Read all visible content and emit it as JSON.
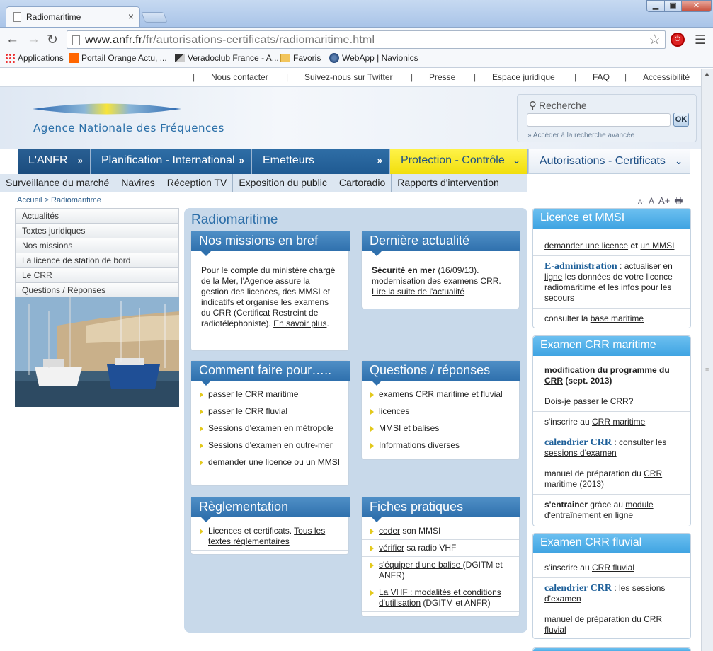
{
  "browser": {
    "tab_title": "Radiomaritime",
    "tab_close": "×",
    "url_host": "www.anfr.fr",
    "url_path": "/fr/autorisations-certificats/radiomaritime.html",
    "window_min": "▁",
    "window_max": "▣",
    "window_close": "✕",
    "bookmarks": [
      "Applications",
      "Portail Orange  Actu, ...",
      "Veradoclub France - A...",
      "Favoris",
      "WebApp | Navionics"
    ]
  },
  "toplinks": [
    "Nous contacter",
    "Suivez-nous sur Twitter",
    "Presse",
    "Espace juridique",
    "FAQ",
    "Accessibilité"
  ],
  "toplinks_sep": "|",
  "header": {
    "logo_text": "Agence Nationale des Fréquences",
    "search_title": "Recherche",
    "search_ok": "OK",
    "search_advanced": "Accéder à la recherche avancée",
    "search_advanced_marker": "»"
  },
  "mainnav": [
    {
      "label": "L'ANFR",
      "chev": "»"
    },
    {
      "label": "Planification - International",
      "chev": "»"
    },
    {
      "label": "Emetteurs",
      "chev": "»"
    },
    {
      "label": "Protection - Contrôle",
      "chev": "⌄"
    },
    {
      "label": "Autorisations - Certificats",
      "chev": "⌄"
    }
  ],
  "subnav": [
    "Surveillance du marché",
    "Navires",
    "Réception TV",
    "Exposition du public",
    "Cartoradio",
    "Rapports d'intervention"
  ],
  "breadcrumb": "Accueil > Radiomaritime",
  "fontsize": {
    "small": "A-",
    "normal": "A",
    "large": "A+",
    "print": "🖶"
  },
  "leftmenu": [
    "Actualités",
    "Textes juridiques",
    "Nos missions",
    "La licence de station de bord",
    "Le CRR",
    "Questions / Réponses"
  ],
  "center": {
    "title": "Radiomaritime",
    "missions": {
      "title": "Nos missions en bref",
      "text": "Pour le compte du ministère chargé de la Mer, l'Agence assure la gestion des licences, des MMSI et indicatifs et organise les examens du CRR (Certificat Restreint de radiotéléphoniste). ",
      "link": "En savoir plus",
      "end": "."
    },
    "actualite": {
      "title": "Dernière actualité",
      "bold": "Sécurité en mer",
      "date": " (16/09/13).",
      "text": "modernisation des examens CRR.",
      "link": "Lire la suite de l'actualité"
    },
    "comment": {
      "title": "Comment faire pour…..",
      "items": [
        {
          "pre": "passer le ",
          "link": "CRR maritime",
          "post": ""
        },
        {
          "pre": "passer le ",
          "link": "CRR fluvial",
          "post": ""
        },
        {
          "pre": "",
          "link": "Sessions d'examen en métropole",
          "post": ""
        },
        {
          "pre": "",
          "link": "Sessions d'examen en outre-mer",
          "post": ""
        },
        {
          "pre": "demander une ",
          "link": "licence",
          "mid": " ou un ",
          "link2": "MMSI"
        }
      ]
    },
    "questions": {
      "title": "Questions / réponses",
      "items": [
        "examens CRR maritime et fluvial",
        "licences",
        "MMSI et balises",
        "Informations diverses"
      ]
    },
    "reglementation": {
      "title": "Règlementation",
      "pre": "Licences et certificats. ",
      "link": "Tous les textes réglementaires"
    },
    "fiches": {
      "title": "Fiches pratiques",
      "items": [
        {
          "link": "coder",
          "post": " son MMSI"
        },
        {
          "link": "vérifier",
          "post": " sa radio VHF"
        },
        {
          "link": "s'équiper d'une balise ",
          "post": "(DGITM et ANFR)"
        },
        {
          "link": "La VHF : modalités et conditions d'utilisation",
          "post": " (DGITM et ANFR)"
        }
      ]
    }
  },
  "right": {
    "licence": {
      "title": "Licence et MMSI",
      "i1_link1": "demander une licence",
      "i1_mid": " et ",
      "i1_link2": "un MMSI",
      "i2_serif": "E-administration",
      "i2_colon": " : ",
      "i2_link": "actualiser en ligne",
      "i2_text": " les données de votre licence radiomaritime et les infos pour les secours",
      "i3_pre": "consulter la ",
      "i3_link": "base maritime"
    },
    "maritime": {
      "title": "Examen CRR maritime",
      "i1_link": "modification du programme du CRR",
      "i1_post": " (sept. 2013)",
      "i2_link": "Dois-je passer le CRR",
      "i2_post": "?",
      "i3_pre": "s'inscrire au ",
      "i3_link": "CRR maritime",
      "i4_serif": "calendrier CRR",
      "i4_mid": " :  consulter les ",
      "i4_link": "sessions d'examen",
      "i5_pre": "manuel de préparation du ",
      "i5_link": "CRR maritime",
      "i5_post": " (2013)",
      "i6_bold": "s'entrainer",
      "i6_mid": " grâce au ",
      "i6_link": "module d'entraînement en ligne"
    },
    "fluvial": {
      "title": "Examen CRR fluvial",
      "i1_pre": "s'inscrire au ",
      "i1_link": "CRR fluvial",
      "i2_serif": "calendrier CRR",
      "i2_mid": " :  les ",
      "i2_link": "sessions d'examen",
      "i3_pre": "manuel de préparation du ",
      "i3_link": "CRR fluvial"
    }
  }
}
